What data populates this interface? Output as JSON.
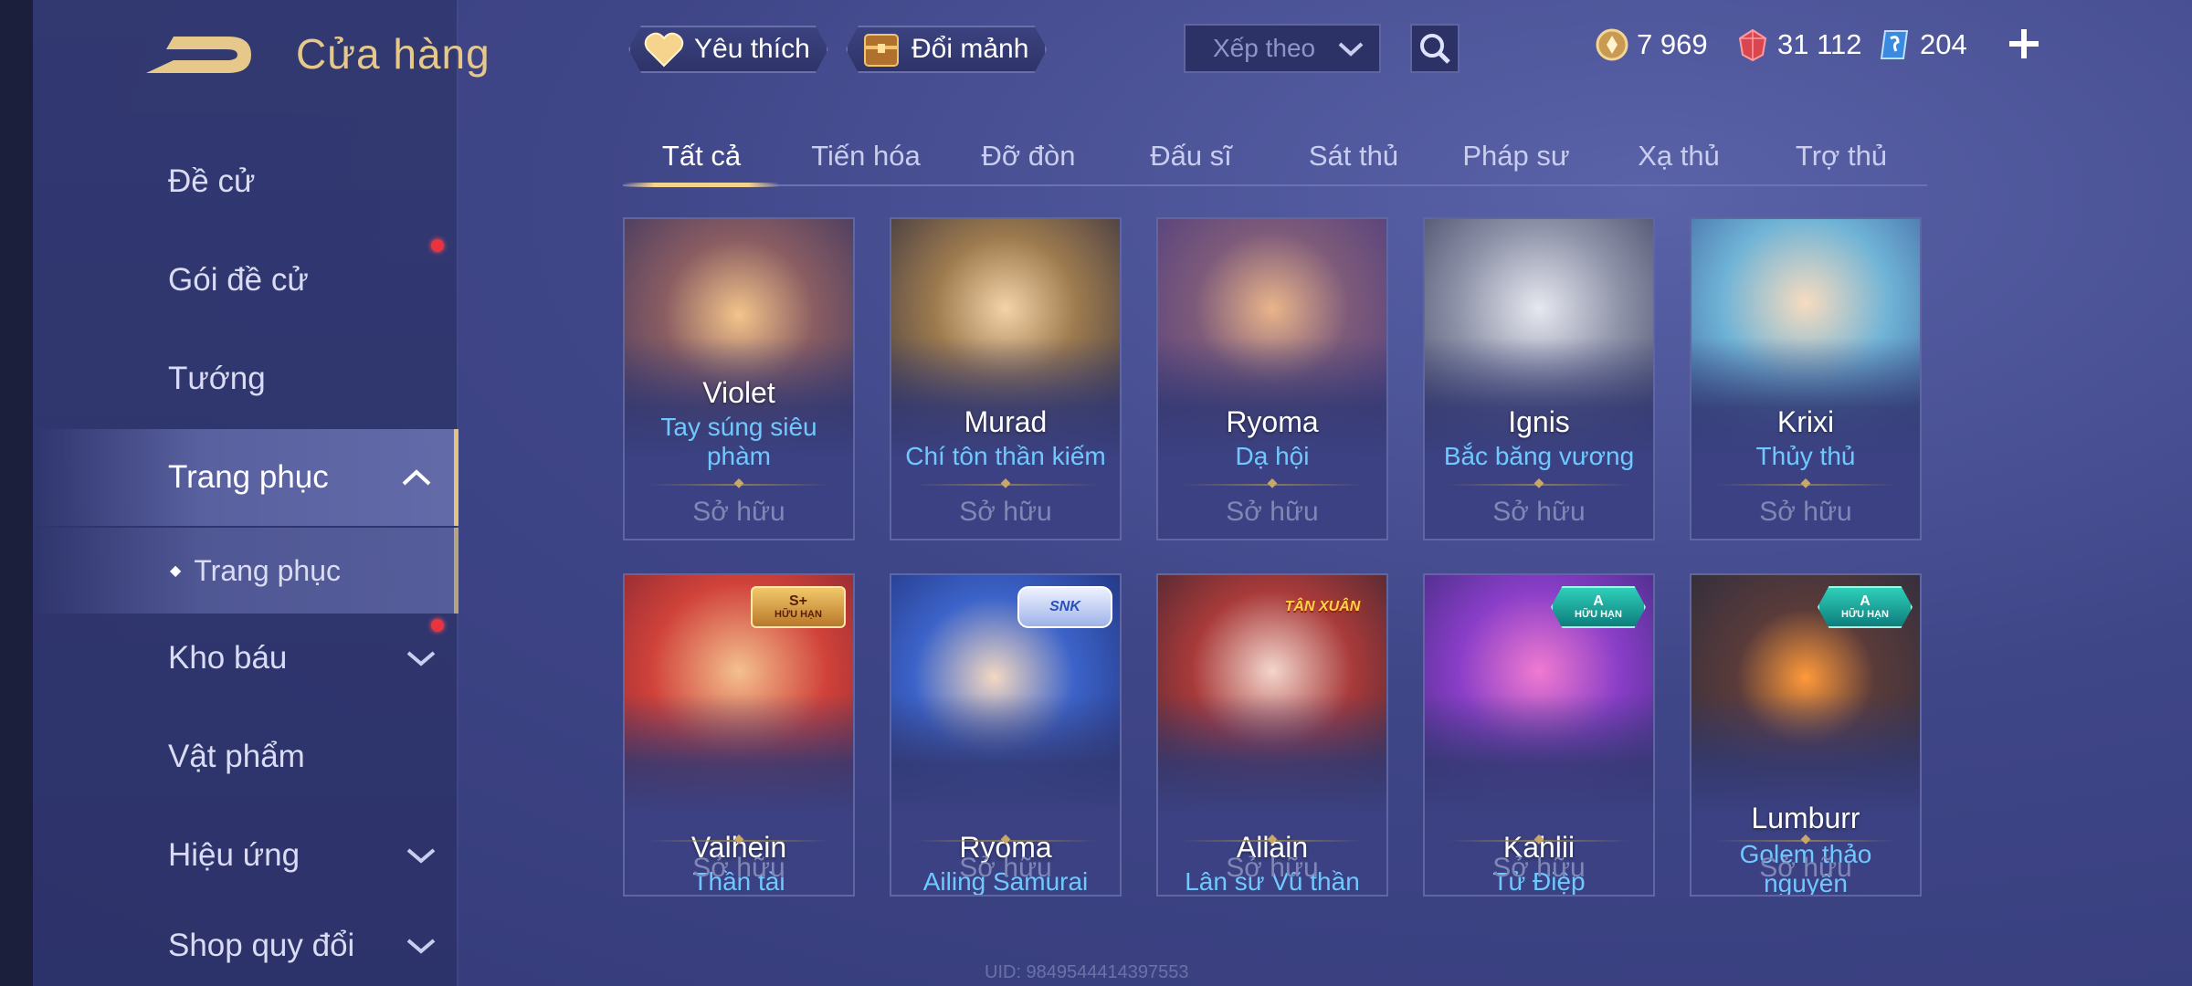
{
  "header": {
    "title": "Cửa hàng",
    "favorites_label": "Yêu thích",
    "exchange_label": "Đổi mảnh",
    "sort_label": "Xếp theo"
  },
  "currencies": [
    {
      "name": "gold-coin",
      "value": "7 969"
    },
    {
      "name": "red-gem",
      "value": "31 112"
    },
    {
      "name": "blue-voucher",
      "value": "204"
    }
  ],
  "sidebar": {
    "items": [
      {
        "label": "Đề cử"
      },
      {
        "label": "Gói đề cử"
      },
      {
        "label": "Tướng"
      },
      {
        "label": "Trang phục"
      },
      {
        "label": "Trang phục"
      },
      {
        "label": "Kho báu"
      },
      {
        "label": "Vật phẩm"
      },
      {
        "label": "Hiệu ứng"
      },
      {
        "label": "Shop quy đổi"
      }
    ]
  },
  "tabs": [
    {
      "label": "Tất cả"
    },
    {
      "label": "Tiến hóa"
    },
    {
      "label": "Đỡ đòn"
    },
    {
      "label": "Đấu sĩ"
    },
    {
      "label": "Sát thủ"
    },
    {
      "label": "Pháp sư"
    },
    {
      "label": "Xạ thủ"
    },
    {
      "label": "Trợ thủ"
    }
  ],
  "cards": [
    {
      "hero": "Violet",
      "skin": "Tay súng siêu phàm",
      "status": "Sở hữu"
    },
    {
      "hero": "Murad",
      "skin": "Chí tôn thần kiếm",
      "status": "Sở hữu"
    },
    {
      "hero": "Ryoma",
      "skin": "Dạ hội",
      "status": "Sở hữu"
    },
    {
      "hero": "Ignis",
      "skin": "Bắc băng vương",
      "status": "Sở hữu"
    },
    {
      "hero": "Krixi",
      "skin": "Thủy thủ",
      "status": "Sở hữu"
    },
    {
      "hero": "Valhein",
      "skin": "Thần tài",
      "status": "Sở hữu",
      "badge": {
        "t1": "S+",
        "t2": "HỮU HẠN"
      }
    },
    {
      "hero": "Ryoma",
      "skin": "Ailing Samurai",
      "status": "Sở hữu",
      "badge": {
        "t1": "SNK"
      }
    },
    {
      "hero": "Allain",
      "skin": "Lân sư Vũ thần",
      "status": "Sở hữu",
      "badge": {
        "t1": "TÂN XUÂN"
      }
    },
    {
      "hero": "Kahlii",
      "skin": "Tử Điệp",
      "status": "Sở hữu",
      "badge": {
        "t1": "A",
        "t2": "HỮU HẠN"
      }
    },
    {
      "hero": "Lumburr",
      "skin": "Golem thảo nguyên",
      "status": "Sở hữu",
      "badge": {
        "t1": "A",
        "t2": "HỮU HẠN"
      }
    }
  ],
  "footer": {
    "uid": "UID: 9849544414397553"
  },
  "colors": {
    "accent_gold": "#e6c98a",
    "skin_blue": "#6fc9ff",
    "background": "#3f4688"
  }
}
